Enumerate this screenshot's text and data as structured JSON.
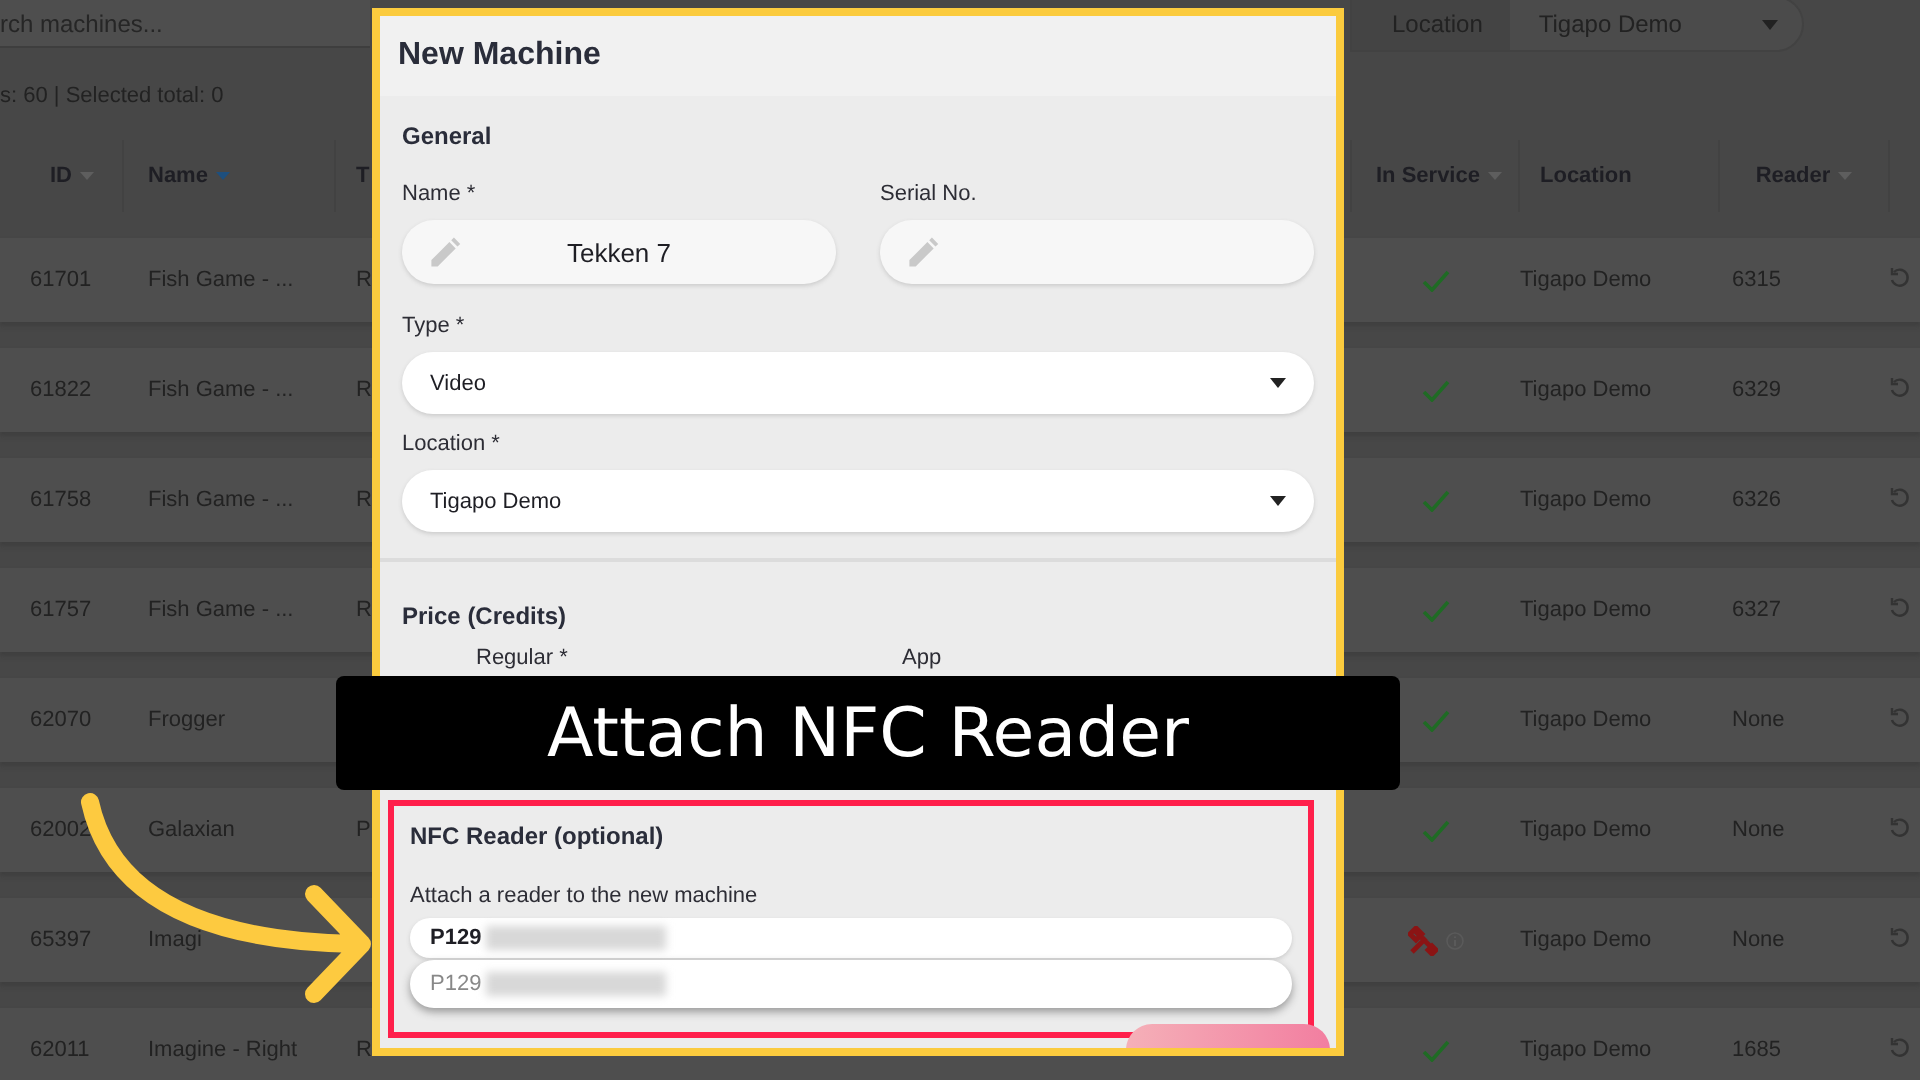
{
  "search": {
    "placeholder": "rch machines..."
  },
  "location_filter": {
    "label": "Location",
    "value": "Tigapo Demo"
  },
  "summary": "s: 60 | Selected total: 0",
  "table": {
    "columns": [
      {
        "label": "ID",
        "sortable": true,
        "selected": false
      },
      {
        "label": "Name",
        "sortable": true,
        "selected": true
      },
      {
        "label": "T",
        "sortable": false,
        "selected": false
      },
      {
        "label": "In Service",
        "sortable": true,
        "selected": false
      },
      {
        "label": "Location",
        "sortable": false,
        "selected": false
      },
      {
        "label": "Reader",
        "sortable": true,
        "selected": false
      }
    ],
    "rows": [
      {
        "id": "61701",
        "name": "Fish Game - ...",
        "type": "R",
        "in_service": true,
        "location": "Tigapo Demo",
        "reader": "6315"
      },
      {
        "id": "61822",
        "name": "Fish Game - ...",
        "type": "R",
        "in_service": true,
        "location": "Tigapo Demo",
        "reader": "6329"
      },
      {
        "id": "61758",
        "name": "Fish Game - ...",
        "type": "R",
        "in_service": true,
        "location": "Tigapo Demo",
        "reader": "6326"
      },
      {
        "id": "61757",
        "name": "Fish Game - ...",
        "type": "R",
        "in_service": true,
        "location": "Tigapo Demo",
        "reader": "6327"
      },
      {
        "id": "62070",
        "name": "Frogger",
        "in_service": true,
        "location": "Tigapo Demo",
        "reader": "None"
      },
      {
        "id": "62002",
        "name": "Galaxian",
        "type": "P",
        "in_service": true,
        "location": "Tigapo Demo",
        "reader": "None"
      },
      {
        "id": "65397",
        "name": "Imagi",
        "in_service": false,
        "location": "Tigapo Demo",
        "reader": "None"
      },
      {
        "id": "62011",
        "name": "Imagine - Right",
        "type": "R",
        "in_service": true,
        "location": "Tigapo Demo",
        "reader": "1685"
      }
    ]
  },
  "dialog": {
    "title": "New Machine",
    "general": {
      "heading": "General",
      "name": {
        "label": "Name *",
        "value": "Tekken 7"
      },
      "serial": {
        "label": "Serial No."
      },
      "type": {
        "label": "Type *",
        "value": "Video"
      },
      "location": {
        "label": "Location *",
        "value": "Tigapo Demo"
      }
    },
    "price": {
      "heading": "Price (Credits)",
      "regular_label": "Regular *",
      "app_label": "App"
    },
    "nfc": {
      "heading": "NFC Reader (optional)",
      "hint": "Attach a reader to the new machine",
      "value": "P129",
      "suggestion": "P129"
    }
  },
  "caption": "Attach NFC Reader"
}
